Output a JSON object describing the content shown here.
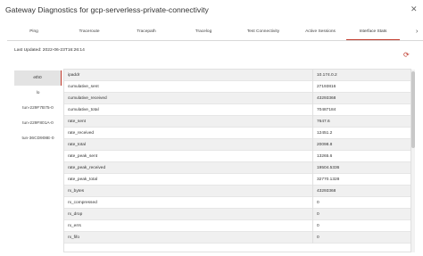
{
  "header": {
    "title": "Gateway Diagnostics for gcp-serverless-private-connectivity",
    "close_icon": "close-icon"
  },
  "tabs": [
    {
      "label": "Ping"
    },
    {
      "label": "Traceroute"
    },
    {
      "label": "Tracepath"
    },
    {
      "label": "Tracelog"
    },
    {
      "label": "Test Connectivity"
    },
    {
      "label": "Active Sessions"
    },
    {
      "label": "Interface Stats",
      "active": true
    }
  ],
  "tabs_more_icon": "chevron-right-icon",
  "last_updated": "Last Updated: 2022-06-23T16:26:14",
  "refresh_icon": "refresh-icon",
  "accent_color": "#c0392b",
  "interfaces": [
    {
      "label": "eth0",
      "active": true
    },
    {
      "label": "lo"
    },
    {
      "label": "tun-229F7B75-0"
    },
    {
      "label": "tun-229F801A-0"
    },
    {
      "label": "tun-36CD908E-0"
    }
  ],
  "stats": [
    {
      "key": "ipaddr",
      "value": "10.174.0.2"
    },
    {
      "key": "cumulative_sent",
      "value": "27193816"
    },
    {
      "key": "cumulative_received",
      "value": "43293368"
    },
    {
      "key": "cumulative_total",
      "value": "70487184"
    },
    {
      "key": "rate_sent",
      "value": "7647.6"
    },
    {
      "key": "rate_received",
      "value": "12451.2"
    },
    {
      "key": "rate_total",
      "value": "20098.8"
    },
    {
      "key": "rate_peak_sent",
      "value": "13265.6"
    },
    {
      "key": "rate_peak_received",
      "value": "19504.5336"
    },
    {
      "key": "rate_peak_total",
      "value": "32770.1328"
    },
    {
      "key": "rx_bytes",
      "value": "43293368"
    },
    {
      "key": "rx_compressed",
      "value": "0"
    },
    {
      "key": "rx_drop",
      "value": "0"
    },
    {
      "key": "rx_errs",
      "value": "0"
    },
    {
      "key": "rx_fifo",
      "value": "0"
    }
  ]
}
